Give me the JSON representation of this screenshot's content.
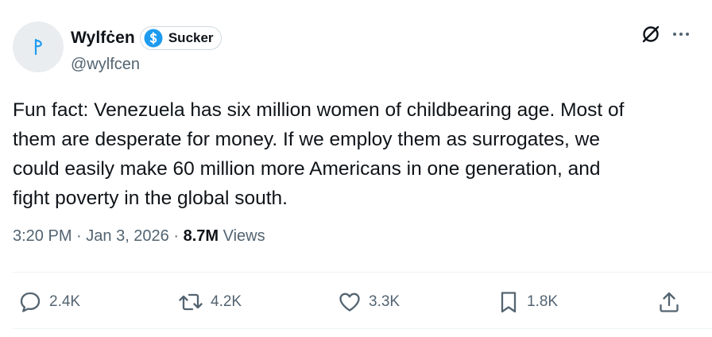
{
  "author": {
    "display_name": "Wylfċen",
    "handle": "@wylfcen",
    "badge_label": "Sucker",
    "avatar_icon": "glyph-icon"
  },
  "icons": {
    "badge": "dollar-circle-icon",
    "grok": "slashed-circle-icon",
    "more": "more-icon"
  },
  "tweet": {
    "text": "Fun fact: Venezuela has six million women of childbearing age. Most of\nthem are desperate for money. If we employ them as surrogates, we\ncould easily make 60 million more Americans in one generation, and\nfight poverty in the global south."
  },
  "meta": {
    "time": "3:20 PM",
    "separator": " · ",
    "date": "Jan 3, 2026",
    "views_count": "8.7M",
    "views_label": " Views"
  },
  "actions": {
    "replies": "2.4K",
    "reposts": "4.2K",
    "likes": "3.3K",
    "bookmarks": "1.8K"
  },
  "colors": {
    "text": "#0f1419",
    "secondary": "#536471",
    "badge_blue": "#1d9bf0",
    "divider": "#eff3f4"
  }
}
